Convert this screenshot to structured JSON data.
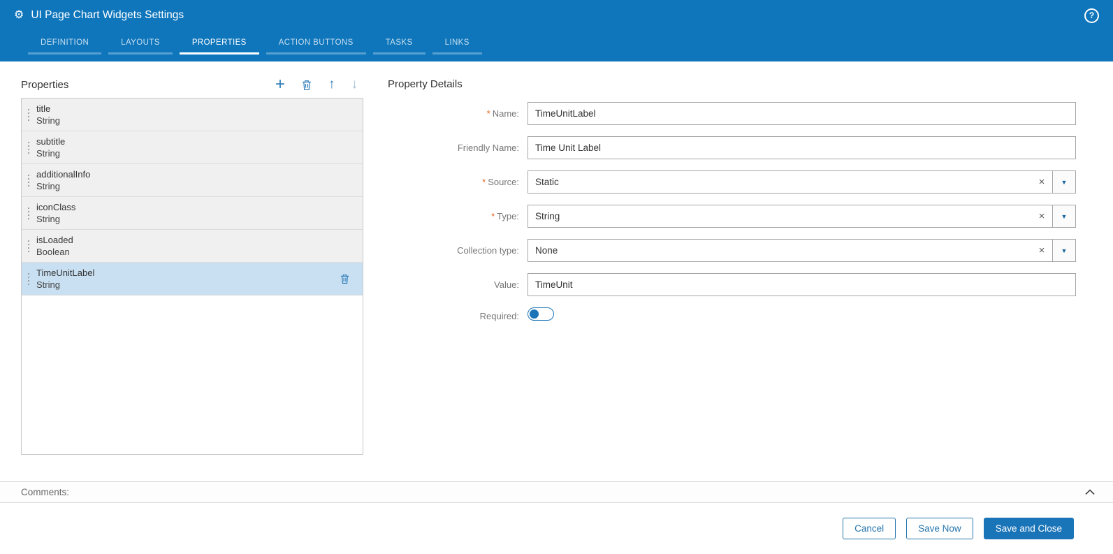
{
  "header": {
    "title": "UI Page Chart Widgets Settings",
    "tabs": [
      {
        "label": "DEFINITION"
      },
      {
        "label": "LAYOUTS"
      },
      {
        "label": "PROPERTIES",
        "active": true
      },
      {
        "label": "ACTION BUTTONS"
      },
      {
        "label": "TASKS"
      },
      {
        "label": "LINKS"
      }
    ]
  },
  "icons": {
    "gear": "⚙",
    "help": "?",
    "plus": "+",
    "up": "↑",
    "down": "↓",
    "clear": "×",
    "caret": "▼"
  },
  "properties_panel": {
    "title": "Properties",
    "items": [
      {
        "name": "title",
        "type": "String"
      },
      {
        "name": "subtitle",
        "type": "String"
      },
      {
        "name": "additionalInfo",
        "type": "String"
      },
      {
        "name": "iconClass",
        "type": "String"
      },
      {
        "name": "isLoaded",
        "type": "Boolean"
      },
      {
        "name": "TimeUnitLabel",
        "type": "String",
        "selected": true
      }
    ]
  },
  "details": {
    "title": "Property Details",
    "required_marker": "*",
    "name": {
      "label": "Name:",
      "value": "TimeUnitLabel",
      "required": true
    },
    "friendly_name": {
      "label": "Friendly Name:",
      "value": "Time Unit Label",
      "required": false
    },
    "source": {
      "label": "Source:",
      "value": "Static",
      "required": true
    },
    "type": {
      "label": "Type:",
      "value": "String",
      "required": true
    },
    "collection_type": {
      "label": "Collection type:",
      "value": "None",
      "required": false
    },
    "value": {
      "label": "Value:",
      "value": "TimeUnit",
      "required": false
    },
    "required_toggle": {
      "label": "Required:",
      "state": "off"
    }
  },
  "comments": {
    "label": "Comments:"
  },
  "footer": {
    "cancel": "Cancel",
    "save_now": "Save Now",
    "save_and_close": "Save and Close"
  },
  "colors": {
    "header_blue": "#0f76bc",
    "accent_blue": "#1a74b8",
    "selected_row": "#c9e0f2",
    "required_asterisk": "#e0641c"
  }
}
